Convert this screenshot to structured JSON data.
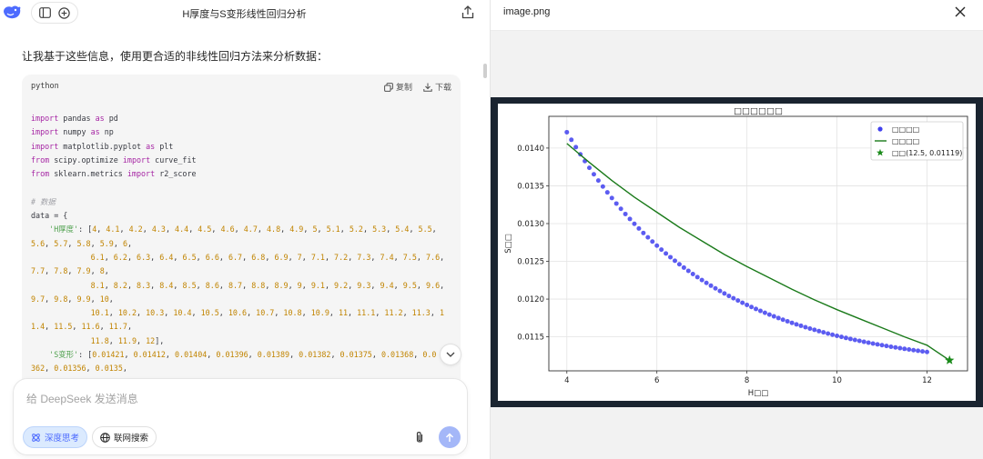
{
  "header": {
    "title": "H厚度与S变形线性回归分析"
  },
  "message": {
    "intro": "让我基于这些信息，使用更合适的非线性回归方法来分析数据："
  },
  "code": {
    "language": "python",
    "copy_label": "复制",
    "download_label": "下载",
    "lines": [
      [
        [
          "k",
          "import"
        ],
        [
          "t",
          " pandas "
        ],
        [
          "k",
          "as"
        ],
        [
          "t",
          " pd"
        ]
      ],
      [
        [
          "k",
          "import"
        ],
        [
          "t",
          " numpy "
        ],
        [
          "k",
          "as"
        ],
        [
          "t",
          " np"
        ]
      ],
      [
        [
          "k",
          "import"
        ],
        [
          "t",
          " matplotlib.pyplot "
        ],
        [
          "k",
          "as"
        ],
        [
          "t",
          " plt"
        ]
      ],
      [
        [
          "k",
          "from"
        ],
        [
          "t",
          " scipy.optimize "
        ],
        [
          "k",
          "import"
        ],
        [
          "t",
          " curve_fit"
        ]
      ],
      [
        [
          "k",
          "from"
        ],
        [
          "t",
          " sklearn.metrics "
        ],
        [
          "k",
          "import"
        ],
        [
          "t",
          " r2_score"
        ]
      ],
      [],
      [
        [
          "c",
          "# 数据"
        ]
      ],
      [
        [
          "t",
          "data = {"
        ]
      ],
      [
        [
          "t",
          "    "
        ],
        [
          "s",
          "'H厚度'"
        ],
        [
          "t",
          ": ["
        ],
        [
          "n",
          "4"
        ],
        [
          "t",
          ", "
        ],
        [
          "n",
          "4.1"
        ],
        [
          "t",
          ", "
        ],
        [
          "n",
          "4.2"
        ],
        [
          "t",
          ", "
        ],
        [
          "n",
          "4.3"
        ],
        [
          "t",
          ", "
        ],
        [
          "n",
          "4.4"
        ],
        [
          "t",
          ", "
        ],
        [
          "n",
          "4.5"
        ],
        [
          "t",
          ", "
        ],
        [
          "n",
          "4.6"
        ],
        [
          "t",
          ", "
        ],
        [
          "n",
          "4.7"
        ],
        [
          "t",
          ", "
        ],
        [
          "n",
          "4.8"
        ],
        [
          "t",
          ", "
        ],
        [
          "n",
          "4.9"
        ],
        [
          "t",
          ", "
        ],
        [
          "n",
          "5"
        ],
        [
          "t",
          ", "
        ],
        [
          "n",
          "5.1"
        ],
        [
          "t",
          ", "
        ],
        [
          "n",
          "5.2"
        ],
        [
          "t",
          ", "
        ],
        [
          "n",
          "5.3"
        ],
        [
          "t",
          ", "
        ],
        [
          "n",
          "5.4"
        ],
        [
          "t",
          ", "
        ],
        [
          "n",
          "5.5"
        ],
        [
          "t",
          ","
        ]
      ],
      [
        [
          "n",
          "5.6"
        ],
        [
          "t",
          ", "
        ],
        [
          "n",
          "5.7"
        ],
        [
          "t",
          ", "
        ],
        [
          "n",
          "5.8"
        ],
        [
          "t",
          ", "
        ],
        [
          "n",
          "5.9"
        ],
        [
          "t",
          ", "
        ],
        [
          "n",
          "6"
        ],
        [
          "t",
          ","
        ]
      ],
      [
        [
          "t",
          "             "
        ],
        [
          "n",
          "6.1"
        ],
        [
          "t",
          ", "
        ],
        [
          "n",
          "6.2"
        ],
        [
          "t",
          ", "
        ],
        [
          "n",
          "6.3"
        ],
        [
          "t",
          ", "
        ],
        [
          "n",
          "6.4"
        ],
        [
          "t",
          ", "
        ],
        [
          "n",
          "6.5"
        ],
        [
          "t",
          ", "
        ],
        [
          "n",
          "6.6"
        ],
        [
          "t",
          ", "
        ],
        [
          "n",
          "6.7"
        ],
        [
          "t",
          ", "
        ],
        [
          "n",
          "6.8"
        ],
        [
          "t",
          ", "
        ],
        [
          "n",
          "6.9"
        ],
        [
          "t",
          ", "
        ],
        [
          "n",
          "7"
        ],
        [
          "t",
          ", "
        ],
        [
          "n",
          "7.1"
        ],
        [
          "t",
          ", "
        ],
        [
          "n",
          "7.2"
        ],
        [
          "t",
          ", "
        ],
        [
          "n",
          "7.3"
        ],
        [
          "t",
          ", "
        ],
        [
          "n",
          "7.4"
        ],
        [
          "t",
          ", "
        ],
        [
          "n",
          "7.5"
        ],
        [
          "t",
          ", "
        ],
        [
          "n",
          "7.6"
        ],
        [
          "t",
          ","
        ]
      ],
      [
        [
          "n",
          "7.7"
        ],
        [
          "t",
          ", "
        ],
        [
          "n",
          "7.8"
        ],
        [
          "t",
          ", "
        ],
        [
          "n",
          "7.9"
        ],
        [
          "t",
          ", "
        ],
        [
          "n",
          "8"
        ],
        [
          "t",
          ","
        ]
      ],
      [
        [
          "t",
          "             "
        ],
        [
          "n",
          "8.1"
        ],
        [
          "t",
          ", "
        ],
        [
          "n",
          "8.2"
        ],
        [
          "t",
          ", "
        ],
        [
          "n",
          "8.3"
        ],
        [
          "t",
          ", "
        ],
        [
          "n",
          "8.4"
        ],
        [
          "t",
          ", "
        ],
        [
          "n",
          "8.5"
        ],
        [
          "t",
          ", "
        ],
        [
          "n",
          "8.6"
        ],
        [
          "t",
          ", "
        ],
        [
          "n",
          "8.7"
        ],
        [
          "t",
          ", "
        ],
        [
          "n",
          "8.8"
        ],
        [
          "t",
          ", "
        ],
        [
          "n",
          "8.9"
        ],
        [
          "t",
          ", "
        ],
        [
          "n",
          "9"
        ],
        [
          "t",
          ", "
        ],
        [
          "n",
          "9.1"
        ],
        [
          "t",
          ", "
        ],
        [
          "n",
          "9.2"
        ],
        [
          "t",
          ", "
        ],
        [
          "n",
          "9.3"
        ],
        [
          "t",
          ", "
        ],
        [
          "n",
          "9.4"
        ],
        [
          "t",
          ", "
        ],
        [
          "n",
          "9.5"
        ],
        [
          "t",
          ", "
        ],
        [
          "n",
          "9.6"
        ],
        [
          "t",
          ","
        ]
      ],
      [
        [
          "n",
          "9.7"
        ],
        [
          "t",
          ", "
        ],
        [
          "n",
          "9.8"
        ],
        [
          "t",
          ", "
        ],
        [
          "n",
          "9.9"
        ],
        [
          "t",
          ", "
        ],
        [
          "n",
          "10"
        ],
        [
          "t",
          ","
        ]
      ],
      [
        [
          "t",
          "             "
        ],
        [
          "n",
          "10.1"
        ],
        [
          "t",
          ", "
        ],
        [
          "n",
          "10.2"
        ],
        [
          "t",
          ", "
        ],
        [
          "n",
          "10.3"
        ],
        [
          "t",
          ", "
        ],
        [
          "n",
          "10.4"
        ],
        [
          "t",
          ", "
        ],
        [
          "n",
          "10.5"
        ],
        [
          "t",
          ", "
        ],
        [
          "n",
          "10.6"
        ],
        [
          "t",
          ", "
        ],
        [
          "n",
          "10.7"
        ],
        [
          "t",
          ", "
        ],
        [
          "n",
          "10.8"
        ],
        [
          "t",
          ", "
        ],
        [
          "n",
          "10.9"
        ],
        [
          "t",
          ", "
        ],
        [
          "n",
          "11"
        ],
        [
          "t",
          ", "
        ],
        [
          "n",
          "11.1"
        ],
        [
          "t",
          ", "
        ],
        [
          "n",
          "11.2"
        ],
        [
          "t",
          ", "
        ],
        [
          "n",
          "11.3"
        ],
        [
          "t",
          ", "
        ],
        [
          "n",
          "1"
        ]
      ],
      [
        [
          "n",
          "1.4"
        ],
        [
          "t",
          ", "
        ],
        [
          "n",
          "11.5"
        ],
        [
          "t",
          ", "
        ],
        [
          "n",
          "11.6"
        ],
        [
          "t",
          ", "
        ],
        [
          "n",
          "11.7"
        ],
        [
          "t",
          ","
        ]
      ],
      [
        [
          "t",
          "             "
        ],
        [
          "n",
          "11.8"
        ],
        [
          "t",
          ", "
        ],
        [
          "n",
          "11.9"
        ],
        [
          "t",
          ", "
        ],
        [
          "n",
          "12"
        ],
        [
          "t",
          "],"
        ]
      ],
      [
        [
          "t",
          "    "
        ],
        [
          "s",
          "'S变形'"
        ],
        [
          "t",
          ": ["
        ],
        [
          "n",
          "0.01421"
        ],
        [
          "t",
          ", "
        ],
        [
          "n",
          "0.01412"
        ],
        [
          "t",
          ", "
        ],
        [
          "n",
          "0.01404"
        ],
        [
          "t",
          ", "
        ],
        [
          "n",
          "0.01396"
        ],
        [
          "t",
          ", "
        ],
        [
          "n",
          "0.01389"
        ],
        [
          "t",
          ", "
        ],
        [
          "n",
          "0.01382"
        ],
        [
          "t",
          ", "
        ],
        [
          "n",
          "0.01375"
        ],
        [
          "t",
          ", "
        ],
        [
          "n",
          "0.01368"
        ],
        [
          "t",
          ", "
        ],
        [
          "n",
          "0.0"
        ]
      ],
      [
        [
          "n",
          "362"
        ],
        [
          "t",
          ", "
        ],
        [
          "n",
          "0.01356"
        ],
        [
          "t",
          ", "
        ],
        [
          "n",
          "0.0135"
        ],
        [
          "t",
          ","
        ]
      ]
    ]
  },
  "composer": {
    "placeholder": "给 DeepSeek 发送消息",
    "deep_think_label": "深度思考",
    "web_search_label": "联网搜索"
  },
  "preview": {
    "filename": "image.png"
  },
  "colors": {
    "accent": "#4d6bfe",
    "point": "#4040ee",
    "fit": "#1a7a1a",
    "star": "#1a8a1a"
  },
  "chart_data": {
    "type": "scatter",
    "title": "□□□□□□",
    "xlabel": "H□□",
    "ylabel": "S□□",
    "xlim": [
      3.6,
      12.9
    ],
    "ylim": [
      0.01105,
      0.01442
    ],
    "xticks": [
      4,
      6,
      8,
      10,
      12
    ],
    "yticks": [
      0.0115,
      0.012,
      0.0125,
      0.013,
      0.0135,
      0.014
    ],
    "ytick_labels": [
      "0.0115",
      "0.0120",
      "0.0125",
      "0.0130",
      "0.0135",
      "0.0140"
    ],
    "grid": true,
    "legend_position": "top-right",
    "series": [
      {
        "name": "□□□□",
        "kind": "points",
        "x_start": 4.0,
        "x_end": 12.0,
        "x_step": 0.1,
        "y_start": 0.01421,
        "y_end": 0.0113
      },
      {
        "name": "□□□□",
        "kind": "line",
        "x": [
          4.0,
          4.5,
          5.0,
          5.5,
          6.0,
          6.5,
          7.0,
          7.5,
          8.0,
          8.5,
          9.0,
          9.5,
          10.0,
          10.5,
          11.0,
          11.5,
          12.0,
          12.5
        ],
        "y": [
          0.01406,
          0.01381,
          0.01357,
          0.01335,
          0.01315,
          0.01295,
          0.01277,
          0.01259,
          0.01243,
          0.01228,
          0.01213,
          0.01199,
          0.01186,
          0.01174,
          0.01162,
          0.0115,
          0.01139,
          0.01119
        ]
      },
      {
        "name": "□□(12.5, 0.01119)",
        "kind": "star",
        "x": [
          12.5
        ],
        "y": [
          0.01119
        ]
      }
    ]
  }
}
